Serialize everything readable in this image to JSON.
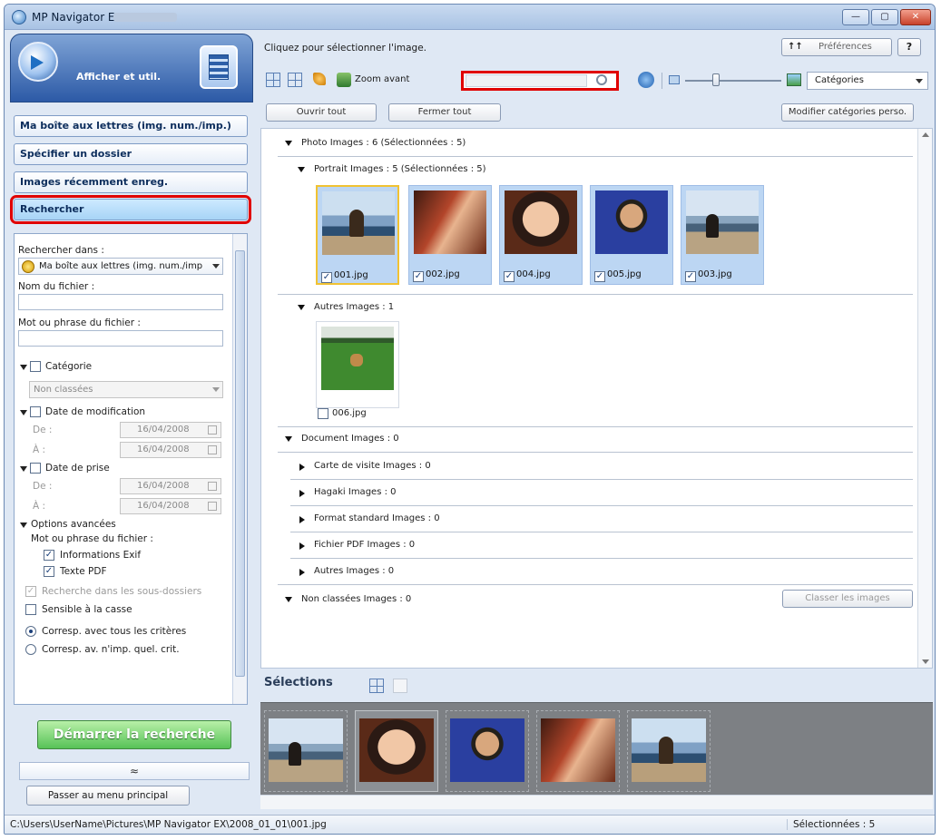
{
  "window": {
    "title": "MP Navigator EX",
    "min": "—",
    "max": "▢",
    "close": "✕"
  },
  "left": {
    "mode_title": "Afficher et util.",
    "nav": {
      "mailbox": "Ma boîte aux lettres (img. num./imp.)",
      "specify_folder": "Spécifier un dossier",
      "recent": "Images récemment enreg.",
      "search": "Rechercher"
    },
    "search": {
      "search_in_label": "Rechercher dans :",
      "search_in_value": "Ma boîte aux lettres (img. num./imp",
      "filename_label": "Nom du fichier :",
      "phrase_label": "Mot ou phrase du fichier :",
      "category_label": "Catégorie",
      "category_value": "Non classées",
      "modified_label": "Date de modification",
      "from_label": "De :",
      "to_label": "À :",
      "modified_from": "16/04/2008",
      "modified_to": "16/04/2008",
      "taken_label": "Date de prise",
      "taken_from": "16/04/2008",
      "taken_to": "16/04/2008",
      "advanced_label": "Options avancées",
      "phrase_in_label": "Mot ou phrase du fichier :",
      "exif_label": "Informations Exif",
      "pdf_label": "Texte PDF",
      "subfolders_label": "Recherche dans les sous-dossiers",
      "case_label": "Sensible à la casse",
      "match_all_label": "Corresp. avec tous les critères",
      "match_any_label": "Corresp. av. n'imp. quel. crit."
    },
    "start_button": "Démarrer la recherche",
    "collapse_glyph": "≈",
    "main_menu_button": "Passer au menu principal"
  },
  "right": {
    "hint": "Cliquez pour sélectionner l'image.",
    "pref_icon": "↑↑",
    "pref_button": "Préférences",
    "help_button": "?",
    "zoom_label": "Zoom avant",
    "view_select": "Catégories",
    "open_all": "Ouvrir tout",
    "close_all": "Fermer tout",
    "edit_categories": "Modifier catégories perso.",
    "photo_header": "Photo   Images : 6   (Sélectionnées : 5)",
    "portrait_header": "Portrait   Images : 5   (Sélectionnées : 5)",
    "thumbs": [
      {
        "name": "001.jpg",
        "checked": "✓"
      },
      {
        "name": "002.jpg",
        "checked": "✓"
      },
      {
        "name": "004.jpg",
        "checked": "✓"
      },
      {
        "name": "005.jpg",
        "checked": "✓"
      },
      {
        "name": "003.jpg",
        "checked": "✓"
      }
    ],
    "others_header": "Autres   Images : 1",
    "other_thumb": "006.jpg",
    "document_header": "Document   Images : 0",
    "doc_items": [
      "Carte de visite   Images : 0",
      "Hagaki   Images : 0",
      "Format standard   Images : 0",
      "Fichier PDF   Images : 0",
      "Autres   Images : 0"
    ],
    "unclassified_header": "Non classées   Images : 0",
    "classify_button": "Classer les images",
    "selections_label": "Sélections"
  },
  "status": {
    "path": "C:\\Users\\UserName\\Pictures\\MP Navigator EX\\2008_01_01\\001.jpg",
    "selected": "Sélectionnées : 5"
  },
  "colors": {
    "highlight": "#e00000",
    "start_button": "#57c257",
    "selection_tray": "#7d8084"
  }
}
